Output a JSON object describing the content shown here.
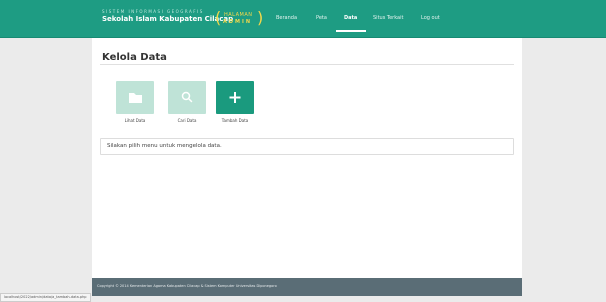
{
  "header": {
    "brand_subtitle": "SISTEM INFORMASI GEOGRAFIS",
    "brand_title": "Sekolah Islam Kabupaten Cilacap",
    "badge_top": "HALAMAN",
    "badge_bottom": "ADMIN",
    "nav": [
      {
        "label": "Beranda",
        "active": false
      },
      {
        "label": "Peta",
        "active": false
      },
      {
        "label": "Data",
        "active": true
      },
      {
        "label": "Situs Terkait",
        "active": false
      },
      {
        "label": "Log out",
        "active": false
      }
    ]
  },
  "main": {
    "title": "Kelola Data",
    "tiles": [
      {
        "label": "Lihat Data",
        "icon": "folder-icon"
      },
      {
        "label": "Cari Data",
        "icon": "search-icon"
      },
      {
        "label": "Tambah Data",
        "icon": "plus-icon"
      }
    ],
    "info_text": "Silakan pilih menu untuk mengelola data."
  },
  "footer": {
    "text": "Copyright © 2014 Kementerian Agama Kabupaten Cilacap & Sistem Komputer Universitas Diponegoro"
  },
  "status_bar": {
    "url": "localhost/2022/admin/data/a_tambah-data.php"
  },
  "colors": {
    "navbar": "#1e9c83",
    "badge": "#f2d84a",
    "tile_light": "#bfe3d7",
    "tile_dark": "#1a9a7e",
    "footer": "#5a6d76"
  }
}
